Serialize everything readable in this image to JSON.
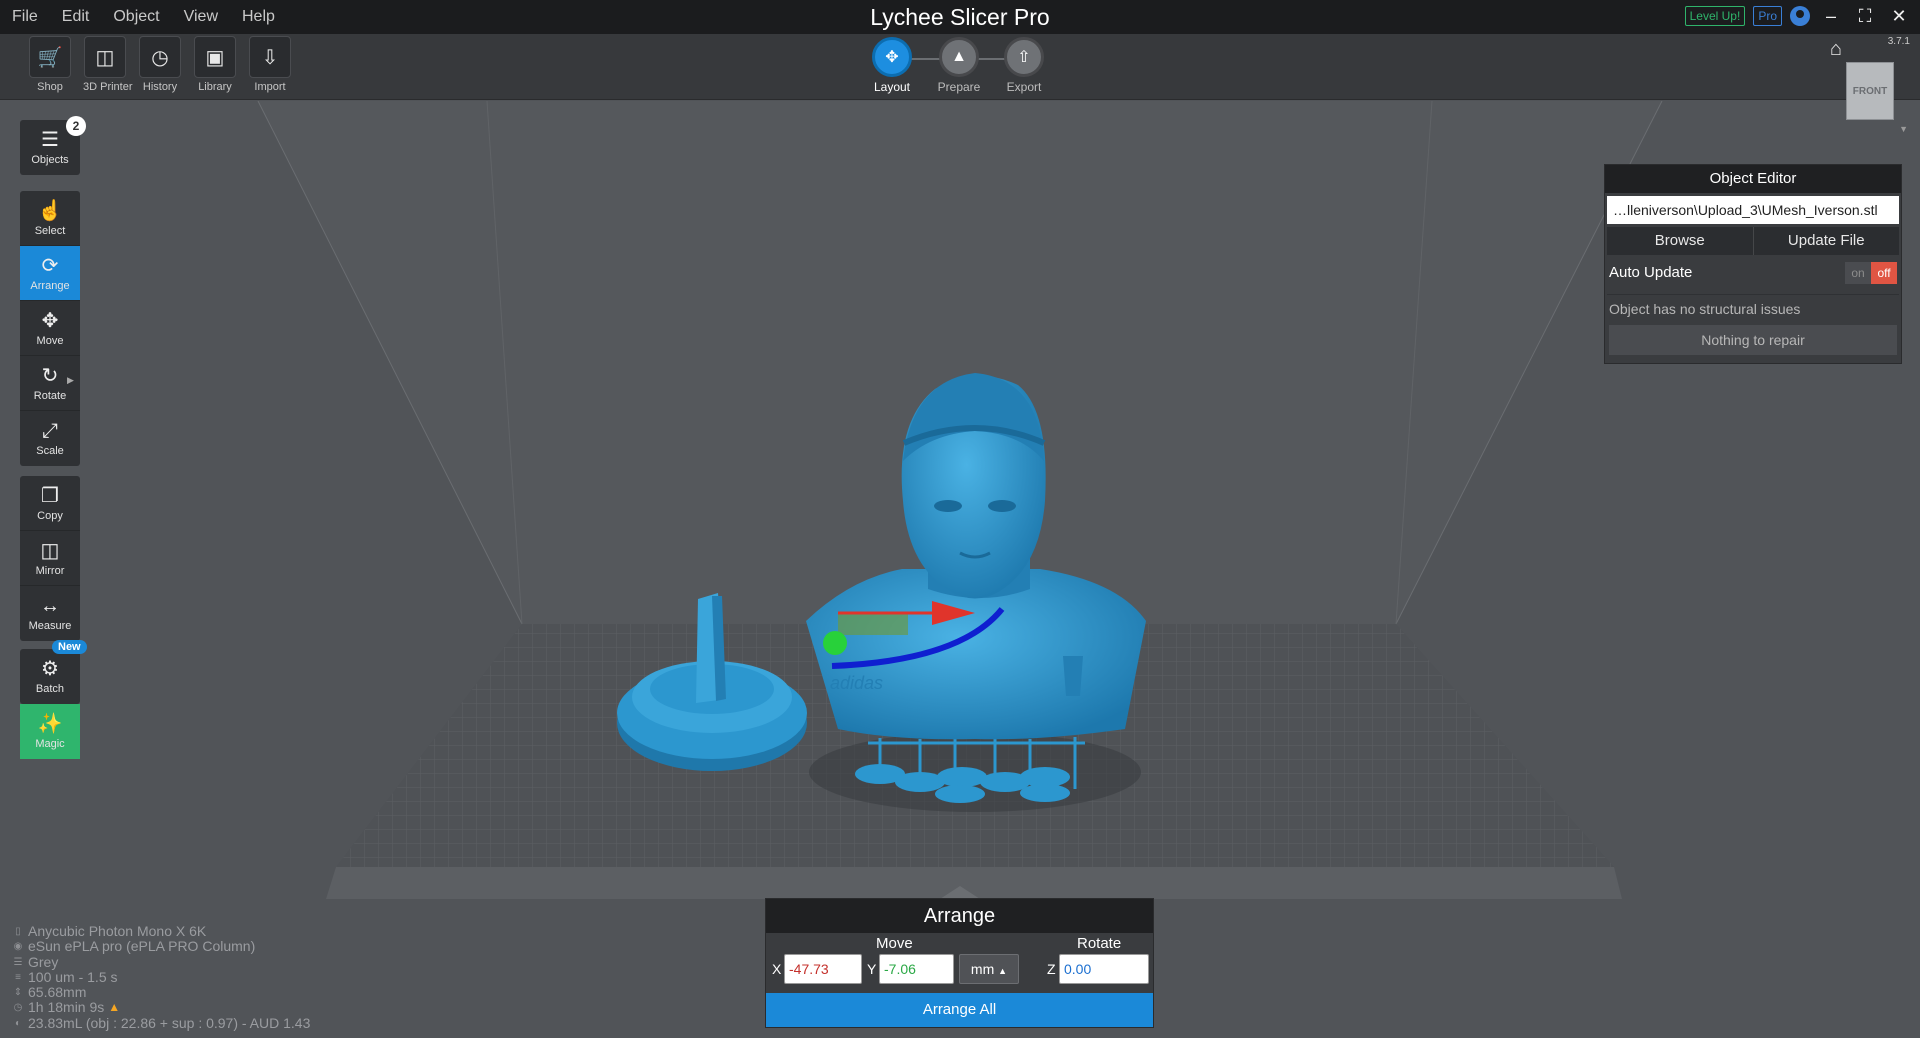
{
  "app": {
    "title": "Lychee Slicer Pro",
    "version": "3.7.1"
  },
  "menu": [
    "File",
    "Edit",
    "Object",
    "View",
    "Help"
  ],
  "titlebar": {
    "level_up": "Level Up!",
    "pro": "Pro"
  },
  "top_tools": [
    {
      "label": "Shop",
      "icon": "cart-icon"
    },
    {
      "label": "3D Printer",
      "icon": "printer-icon"
    },
    {
      "label": "History",
      "icon": "history-icon"
    },
    {
      "label": "Library",
      "icon": "library-icon"
    },
    {
      "label": "Import",
      "icon": "import-icon"
    }
  ],
  "steps": [
    {
      "label": "Layout",
      "active": true
    },
    {
      "label": "Prepare",
      "active": false
    },
    {
      "label": "Export",
      "active": false
    }
  ],
  "view_cube": {
    "label": "FRONT"
  },
  "sidebar": {
    "objects_label": "Objects",
    "objects_count": "2",
    "tools": [
      {
        "label": "Select",
        "icon": "select-icon"
      },
      {
        "label": "Arrange",
        "icon": "arrange-icon",
        "active": true
      },
      {
        "label": "Move",
        "icon": "move-icon"
      },
      {
        "label": "Rotate",
        "icon": "rotate-icon"
      },
      {
        "label": "Scale",
        "icon": "scale-icon"
      }
    ],
    "tools2": [
      {
        "label": "Copy",
        "icon": "copy-icon"
      },
      {
        "label": "Mirror",
        "icon": "mirror-icon"
      },
      {
        "label": "Measure",
        "icon": "measure-icon"
      }
    ],
    "batch_label": "Batch",
    "new_badge": "New",
    "magic_label": "Magic"
  },
  "object_editor": {
    "title": "Object Editor",
    "file_path": "…lleniverson\\Upload_3\\UMesh_Iverson.stl",
    "browse": "Browse",
    "update_file": "Update File",
    "auto_update": "Auto Update",
    "toggle_on": "on",
    "toggle_off": "off",
    "status": "Object has no structural issues",
    "repair": "Nothing to repair"
  },
  "arrange": {
    "title": "Arrange",
    "move_label": "Move",
    "rotate_label": "Rotate",
    "x_label": "X",
    "y_label": "Y",
    "z_label": "Z",
    "x_value": "-47.73",
    "y_value": "-7.06",
    "unit": "mm",
    "z_value": "0.00",
    "arrange_all": "Arrange All"
  },
  "printer_info": {
    "printer": "Anycubic Photon Mono X 6K",
    "resin": "eSun ePLA pro (ePLA PRO Column)",
    "color": "Grey",
    "layer": "100 um - 1.5 s",
    "height": "65.68mm",
    "time": "1h 18min 9s",
    "volume": "23.83mL (obj : 22.86 + sup : 0.97) - AUD 1.43"
  },
  "colors": {
    "accent": "#1b89d8",
    "magic": "#2fb56d",
    "model": "#2c97cf",
    "toggle_off": "#e05543"
  }
}
